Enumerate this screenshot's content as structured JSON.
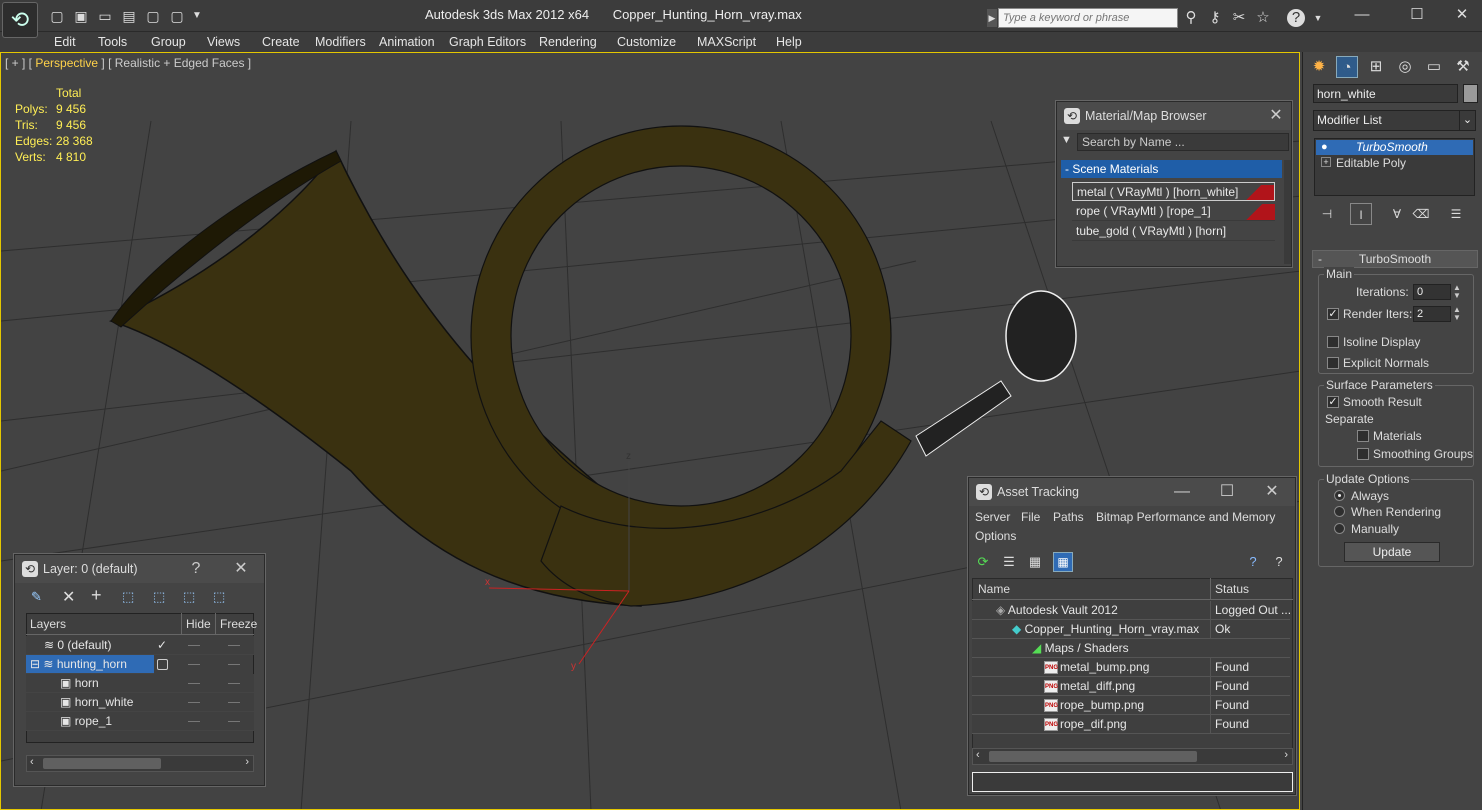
{
  "titlebar": {
    "app": "Autodesk 3ds Max  2012 x64",
    "file": "Copper_Hunting_Horn_vray.max",
    "search_placeholder": "Type a keyword or phrase",
    "minimize": "—",
    "maximize": "☐",
    "close": "✕"
  },
  "menu": [
    "Edit",
    "Tools",
    "Group",
    "Views",
    "Create",
    "Modifiers",
    "Animation",
    "Graph Editors",
    "Rendering",
    "Customize",
    "MAXScript",
    "Help"
  ],
  "viewport": {
    "label_pre": "[ + ] [ ",
    "label_view": "Perspective",
    "label_post": " ] [ Realistic + Edged Faces ]",
    "stats": {
      "header": "Total",
      "rows": [
        {
          "label": "Polys:",
          "value": "9 456"
        },
        {
          "label": "Tris:",
          "value": "9 456"
        },
        {
          "label": "Edges:",
          "value": "28 368"
        },
        {
          "label": "Verts:",
          "value": "4 810"
        }
      ]
    },
    "axis": {
      "x": "x",
      "y": "y",
      "z": "z"
    }
  },
  "material_browser": {
    "title": "Material/Map Browser",
    "search": "Search by Name ...",
    "group": "Scene Materials",
    "items": [
      "metal  ( VRayMtl ) [horn_white]",
      "rope  ( VRayMtl ) [rope_1]",
      "tube_gold  ( VRayMtl ) [horn]"
    ]
  },
  "command_panel": {
    "object_name": "horn_white",
    "modifier_list": "Modifier List",
    "stack": [
      "TurboSmooth",
      "Editable Poly"
    ],
    "rollout": "TurboSmooth",
    "main_label": "Main",
    "iterations_label": "Iterations:",
    "iterations": "0",
    "render_iters_label": "Render Iters:",
    "render_iters": "2",
    "isoline": "Isoline Display",
    "explicit": "Explicit Normals",
    "surface_label": "Surface Parameters",
    "smooth_result": "Smooth Result",
    "separate": "Separate",
    "materials": "Materials",
    "smoothing_groups": "Smoothing Groups",
    "update_options": "Update Options",
    "always": "Always",
    "when_rendering": "When Rendering",
    "manually": "Manually",
    "update_button": "Update"
  },
  "asset_tracking": {
    "title": "Asset Tracking",
    "menu": [
      "Server",
      "File",
      "Paths",
      "Bitmap Performance and Memory",
      "Options"
    ],
    "col_name": "Name",
    "col_status": "Status",
    "rows": [
      {
        "name": "Autodesk Vault 2012",
        "status": "Logged Out ..."
      },
      {
        "name": "Copper_Hunting_Horn_vray.max",
        "status": "Ok"
      },
      {
        "name": "Maps / Shaders",
        "status": ""
      },
      {
        "name": "metal_bump.png",
        "status": "Found"
      },
      {
        "name": "metal_diff.png",
        "status": "Found"
      },
      {
        "name": "rope_bump.png",
        "status": "Found"
      },
      {
        "name": "rope_dif.png",
        "status": "Found"
      }
    ],
    "png_badge": "PNG"
  },
  "layer_panel": {
    "title": "Layer: 0 (default)",
    "help": "?",
    "close": "✕",
    "col_layers": "Layers",
    "col_hide": "Hide",
    "col_freeze": "Freeze",
    "rows": [
      "0 (default)",
      "hunting_horn",
      "horn",
      "horn_white",
      "rope_1"
    ]
  }
}
